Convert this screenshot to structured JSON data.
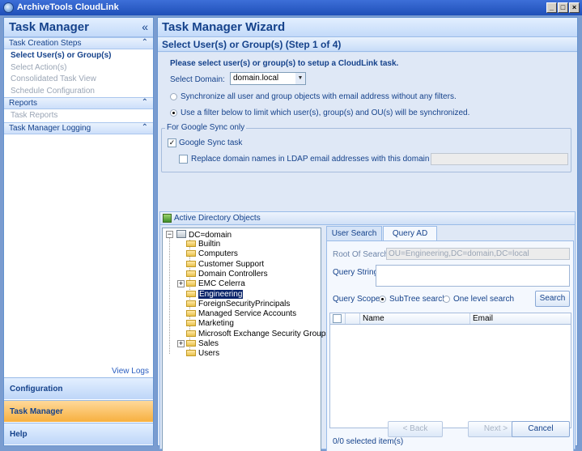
{
  "window": {
    "title": "ArchiveTools CloudLink"
  },
  "left": {
    "title": "Task Manager",
    "collapse_glyph": "«",
    "sections": [
      {
        "label": "Task Creation Steps",
        "items": [
          "Select User(s) or Group(s)",
          "Select Action(s)",
          "Consolidated Task View",
          "Schedule Configuration"
        ]
      },
      {
        "label": "Reports",
        "items": [
          "Task Reports"
        ]
      },
      {
        "label": "Task Manager Logging",
        "items": []
      }
    ],
    "view_logs": "View Logs",
    "nav": [
      "Configuration",
      "Task Manager",
      "Help"
    ]
  },
  "wizard": {
    "title": "Task Manager Wizard",
    "step": "Select User(s) or Group(s) (Step 1 of 4)",
    "intro": "Please select user(s) or group(s) to setup a CloudLink task.",
    "domain_label": "Select Domain:",
    "domain_value": "domain.local",
    "radio_all": "Synchronize all user and group objects with email address without any filters.",
    "radio_filter": "Use a filter below to limit which user(s), group(s) and OU(s) will be synchronized.",
    "google_group": "For Google Sync only",
    "google_sync": "Google Sync task",
    "replace_domain": "Replace domain names in LDAP email addresses with this domain name:"
  },
  "ad": {
    "title": "Active Directory Objects",
    "root": "DC=domain",
    "nodes": [
      "Builtin",
      "Computers",
      "Customer Support",
      "Domain Controllers",
      "EMC Celerra",
      "Engineering",
      "ForeignSecurityPrincipals",
      "Managed Service Accounts",
      "Marketing",
      "Microsoft Exchange Security Groups",
      "Sales",
      "Users"
    ]
  },
  "query": {
    "tabs": [
      "User Search",
      "Query AD"
    ],
    "root_label": "Root Of Search:",
    "root_value": "OU=Engineering,DC=domain,DC=local",
    "string_label": "Query String:",
    "scope_label": "Query Scope:",
    "scope_subtree": "SubTree search",
    "scope_one": "One level search",
    "search_btn": "Search",
    "col_name": "Name",
    "col_email": "Email",
    "status": "0/0 selected item(s)"
  },
  "footer": {
    "back": "< Back",
    "next": "Next >",
    "cancel": "Cancel"
  }
}
